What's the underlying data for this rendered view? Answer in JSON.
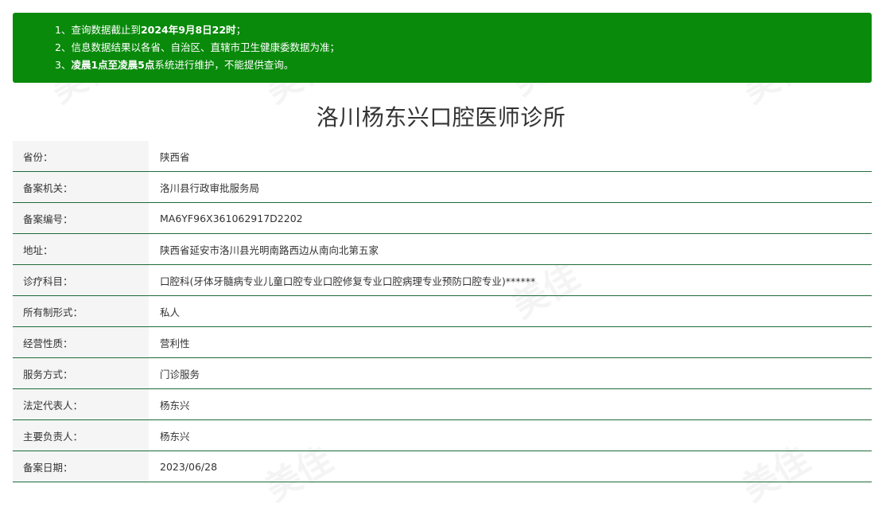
{
  "notice": {
    "line1": {
      "prefix": "1、查询数据截止到",
      "bold": "2024年9月8日22时",
      "suffix": "；"
    },
    "line2": {
      "prefix": "2、信息数据结果以各省、自治区、直辖市卫生健康委数据为准；",
      "bold": "",
      "suffix": ""
    },
    "line3": {
      "prefix": "3、",
      "bold": "凌晨1点至凌晨5点",
      "suffix": "系统进行维护，不能提供查询。"
    }
  },
  "title": "洛川杨东兴口腔医师诊所",
  "rows": [
    {
      "label": "省份：",
      "value": "陕西省"
    },
    {
      "label": "备案机关：",
      "value": "洛川县行政审批服务局"
    },
    {
      "label": "备案编号：",
      "value": "MA6YF96X361062917D2202"
    },
    {
      "label": "地址：",
      "value": "陕西省延安市洛川县光明南路西边从南向北第五家"
    },
    {
      "label": "诊疗科目：",
      "value": "口腔科(牙体牙髓病专业儿童口腔专业口腔修复专业口腔病理专业预防口腔专业)******"
    },
    {
      "label": "所有制形式：",
      "value": "私人"
    },
    {
      "label": "经营性质：",
      "value": "营利性"
    },
    {
      "label": "服务方式：",
      "value": "门诊服务"
    },
    {
      "label": "法定代表人：",
      "value": "杨东兴"
    },
    {
      "label": "主要负责人：",
      "value": "杨东兴"
    },
    {
      "label": "备案日期：",
      "value": "2023/06/28"
    }
  ],
  "watermark": "美佳"
}
